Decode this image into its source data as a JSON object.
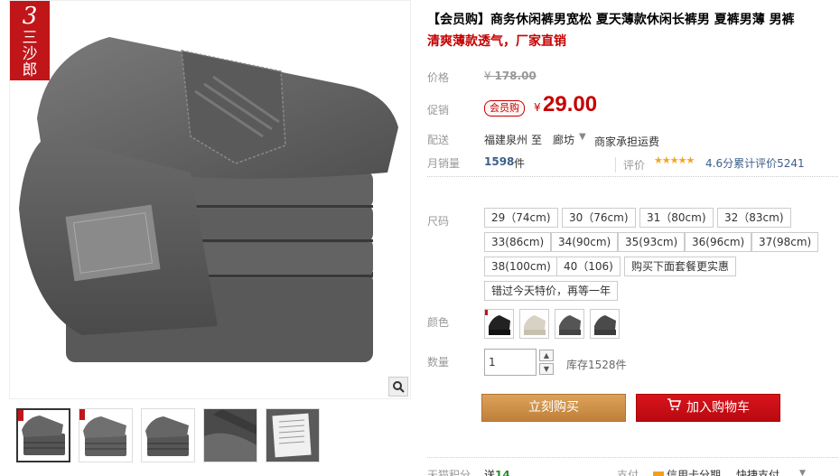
{
  "brand": {
    "number": "3",
    "name": "三沙郎"
  },
  "product": {
    "title": "【会员购】商务休闲裤男宽松 夏天薄款休闲长裤男 夏裤男薄 男裤",
    "subtitle": "清爽薄款透气，厂家直销"
  },
  "price": {
    "label": "价格",
    "currency": "¥",
    "original": "178.00"
  },
  "promo": {
    "label": "促销",
    "badge": "会员购",
    "currency": "¥",
    "value": "29.00"
  },
  "shipping": {
    "label": "配送",
    "from": "福建泉州",
    "to_word": "至",
    "city": "廊坊",
    "fee": "商家承担运费"
  },
  "sales": {
    "label": "月销量",
    "count": "1598",
    "unit": "件",
    "review_label": "评价",
    "rating_text": "4.6分累计评价5241",
    "stars": 4.6
  },
  "sku": {
    "size_label": "尺码",
    "sizes": [
      "29（74cm)",
      "30（76cm)",
      "31（80cm)",
      "32（83cm)",
      "33(86cm)",
      "34(90cm)",
      "35(93cm)",
      "36(96cm)",
      "37(98cm)",
      "38(100cm)",
      "40（106)",
      "购买下面套餐更实惠",
      "错过今天特价，再等一年"
    ],
    "color_label": "颜色",
    "colors": [
      "black",
      "beige",
      "dark-gray",
      "gray"
    ],
    "qty_label": "数量",
    "qty_value": "1",
    "stock": "库存1528件"
  },
  "actions": {
    "buy": "立刻购买",
    "cart": "加入购物车"
  },
  "footer": {
    "tmall_points_label": "天猫积分",
    "send_prefix": "送",
    "send_points": "14",
    "pay_label": "支付",
    "credit": "信用卡分期",
    "fast": "快捷支付"
  },
  "colors": {
    "brand_red": "#c0161a",
    "price_red": "#c40000",
    "buy_orange": "#c88a3c",
    "cart_red": "#c8101a",
    "link_blue": "#3c5f8a"
  }
}
